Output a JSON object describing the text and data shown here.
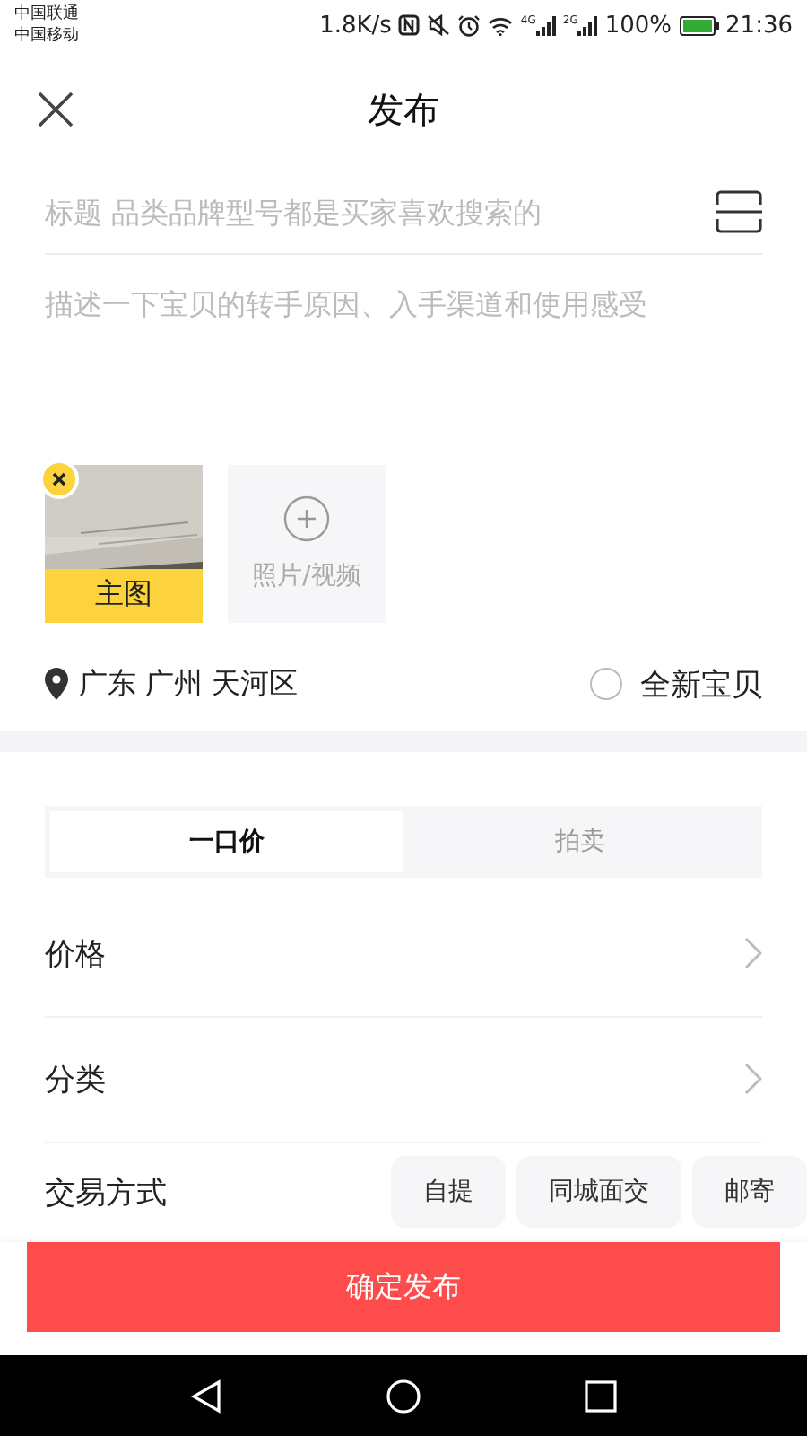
{
  "status_bar": {
    "carriers": [
      "中国联通",
      "中国移动"
    ],
    "speed": "1.8K/s",
    "sim_labels": [
      "4G",
      "2G"
    ],
    "battery": "100%",
    "time": "21:36"
  },
  "header": {
    "title": "发布"
  },
  "title_field": {
    "placeholder": "标题 品类品牌型号都是买家喜欢搜索的"
  },
  "description_field": {
    "placeholder": "描述一下宝贝的转手原因、入手渠道和使用感受"
  },
  "photos": [
    {
      "kind": "picture",
      "label": "主图"
    },
    {
      "kind": "add",
      "label": "照片/视频"
    }
  ],
  "location": "广东 广州 天河区",
  "brand_new": {
    "label": "全新宝贝",
    "checked": false
  },
  "price_tabs": [
    {
      "label": "一口价",
      "selected": true
    },
    {
      "label": "拍卖",
      "selected": false
    }
  ],
  "rows": [
    {
      "label": "价格"
    },
    {
      "label": "分类"
    }
  ],
  "trade": {
    "label": "交易方式",
    "options": [
      "自提",
      "同城面交",
      "邮寄"
    ]
  },
  "submit_button": "确定发布"
}
